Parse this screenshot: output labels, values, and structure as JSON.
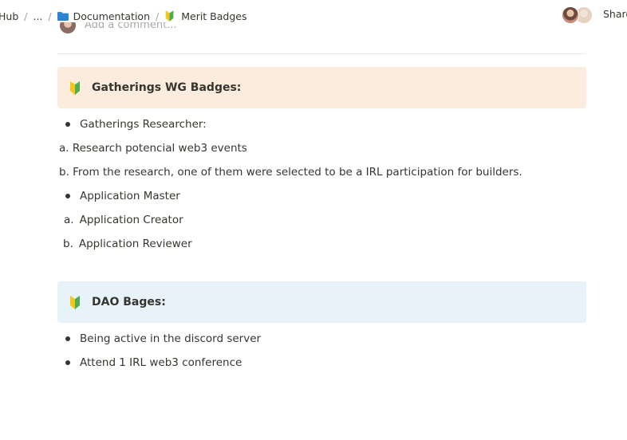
{
  "breadcrumb": {
    "items": [
      "Hub",
      "...",
      "Documentation",
      "Merit Badges"
    ],
    "separator": "/"
  },
  "header": {
    "share_label": "Share"
  },
  "comment": {
    "placeholder": "Add a comment..."
  },
  "sections": [
    {
      "title": "Gatherings WG Badges:",
      "background": "#fbecdd",
      "lines": [
        {
          "type": "bullet",
          "text": "Gatherings Researcher:"
        },
        {
          "type": "text",
          "text": "a. Research potencial web3 events"
        },
        {
          "type": "text",
          "text": "b. From the research, one of them were selected to be a IRL participation for builders."
        },
        {
          "type": "bullet",
          "text": "Application Master"
        },
        {
          "type": "numbered",
          "marker": "a.",
          "text": "Application Creator"
        },
        {
          "type": "numbered",
          "marker": "b.",
          "text": "Application Reviewer"
        }
      ]
    },
    {
      "title": "DAO Bages:",
      "background": "#e7f3f8",
      "lines": [
        {
          "type": "bullet",
          "text": "Being active in the discord server"
        },
        {
          "type": "bullet",
          "text": "Attend 1 IRL web3 conference"
        }
      ]
    }
  ],
  "icons": {
    "folder": "folder-icon",
    "badge": "beginner-badge-icon"
  },
  "colors": {
    "text": "#37352f",
    "folder": "#2a84d2",
    "badge_green": "#4caf50",
    "badge_yellow": "#f5c518"
  }
}
